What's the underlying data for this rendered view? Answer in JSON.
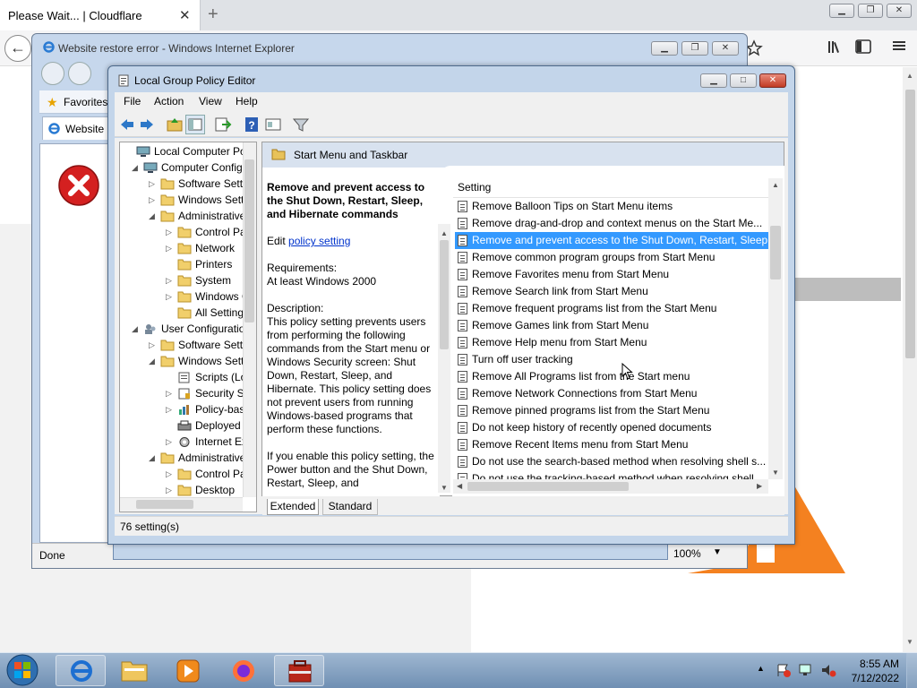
{
  "firefox": {
    "tab_title": "Please Wait... | Cloudflare",
    "close_glyph": "✕",
    "newtab_glyph": "+",
    "back_glyph": "←"
  },
  "ie": {
    "title": "Website restore error - Windows Internet Explorer",
    "favorites_label": "Favorites",
    "tab_label": "Website r",
    "status": "Done",
    "zoom": "100%"
  },
  "gpedit": {
    "title": "Local Group Policy Editor",
    "menu": [
      "File",
      "Action",
      "View",
      "Help"
    ],
    "tree": [
      {
        "label": "Local Computer Polic",
        "level": 0,
        "expander": "",
        "icon": "computer"
      },
      {
        "label": "Computer Config",
        "level": 1,
        "expander": "◢",
        "icon": "computer"
      },
      {
        "label": "Software Setti",
        "level": 2,
        "expander": "▷",
        "icon": "folder"
      },
      {
        "label": "Windows Sett",
        "level": 2,
        "expander": "▷",
        "icon": "folder"
      },
      {
        "label": "Administrative",
        "level": 2,
        "expander": "◢",
        "icon": "folder"
      },
      {
        "label": "Control Pa",
        "level": 3,
        "expander": "▷",
        "icon": "folder"
      },
      {
        "label": "Network",
        "level": 3,
        "expander": "▷",
        "icon": "folder"
      },
      {
        "label": "Printers",
        "level": 3,
        "expander": "",
        "icon": "folder"
      },
      {
        "label": "System",
        "level": 3,
        "expander": "▷",
        "icon": "folder"
      },
      {
        "label": "Windows C",
        "level": 3,
        "expander": "▷",
        "icon": "folder"
      },
      {
        "label": "All Setting",
        "level": 3,
        "expander": "",
        "icon": "folder"
      },
      {
        "label": "User Configuratio",
        "level": 1,
        "expander": "◢",
        "icon": "user"
      },
      {
        "label": "Software Setti",
        "level": 2,
        "expander": "▷",
        "icon": "folder"
      },
      {
        "label": "Windows Sett",
        "level": 2,
        "expander": "◢",
        "icon": "folder"
      },
      {
        "label": "Scripts (Lo",
        "level": 3,
        "expander": "",
        "icon": "script"
      },
      {
        "label": "Security Se",
        "level": 3,
        "expander": "▷",
        "icon": "security"
      },
      {
        "label": "Policy-bas",
        "level": 3,
        "expander": "▷",
        "icon": "chart"
      },
      {
        "label": "Deployed",
        "level": 3,
        "expander": "",
        "icon": "printer"
      },
      {
        "label": "Internet Ex",
        "level": 3,
        "expander": "▷",
        "icon": "gear"
      },
      {
        "label": "Administrative",
        "level": 2,
        "expander": "◢",
        "icon": "folder"
      },
      {
        "label": "Control Pa",
        "level": 3,
        "expander": "▷",
        "icon": "folder"
      },
      {
        "label": "Desktop",
        "level": 3,
        "expander": "▷",
        "icon": "folder"
      }
    ],
    "right_header": "Start Menu and Taskbar",
    "desc": {
      "heading": "Remove and prevent access to the Shut Down, Restart, Sleep, and Hibernate commands",
      "edit_prefix": "Edit ",
      "edit_link": "policy setting",
      "req_label": "Requirements:",
      "req_value": "At least Windows 2000",
      "desc_label": "Description:",
      "desc_text": "This policy setting prevents users from performing the following commands from the Start menu or Windows Security screen: Shut Down, Restart, Sleep, and Hibernate. This policy setting does not prevent users from running Windows-based programs that perform these functions.",
      "enable_text": "If you enable this policy setting, the Power button and the Shut Down, Restart, Sleep, and"
    },
    "list_header": "Setting",
    "settings": [
      "Remove Balloon Tips on Start Menu items",
      "Remove drag-and-drop and context menus on the Start Me...",
      "Remove and prevent access to the Shut Down, Restart, Sleep...",
      "Remove common program groups from Start Menu",
      "Remove Favorites menu from Start Menu",
      "Remove Search link from Start Menu",
      "Remove frequent programs list from the Start Menu",
      "Remove Games link from Start Menu",
      "Remove Help menu from Start Menu",
      "Turn off user tracking",
      "Remove All Programs list from the Start menu",
      "Remove Network Connections from Start Menu",
      "Remove pinned programs list from the Start Menu",
      "Do not keep history of recently opened documents",
      "Remove Recent Items menu from Start Menu",
      "Do not use the search-based method when resolving shell s...",
      "Do not use the tracking-based method when resolving shell..."
    ],
    "selected_index": 2,
    "tabs": [
      "Extended",
      "Standard"
    ],
    "status": "76 setting(s)"
  },
  "taskbar": {
    "time": "8:55 AM",
    "date": "7/12/2022"
  }
}
